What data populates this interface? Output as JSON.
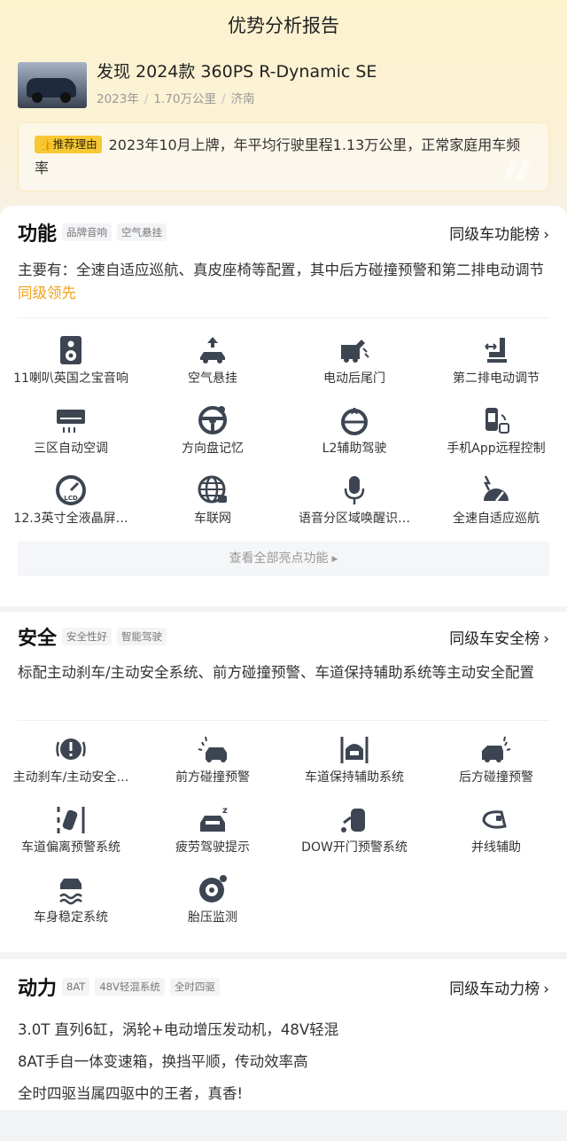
{
  "header": {
    "title": "优势分析报告"
  },
  "car": {
    "name": "发现 2024款 360PS R-Dynamic SE",
    "year": "2023年",
    "mileage": "1.70万公里",
    "city": "济南"
  },
  "reason": {
    "badge": "推荐理由",
    "text": "2023年10月上牌，年平均行驶里程1.13万公里，正常家庭用车频率"
  },
  "function": {
    "title": "功能",
    "tags": [
      "品牌音响",
      "空气悬挂"
    ],
    "rank_label": "同级车功能榜",
    "desc_main": "主要有：全速自适应巡航、真皮座椅等配置，其中后方碰撞预警和第二排电动调节",
    "desc_highlight": "同级领先",
    "items": [
      {
        "label": "11喇叭英国之宝音响",
        "icon": "speaker-icon"
      },
      {
        "label": "空气悬挂",
        "icon": "air-suspension-icon"
      },
      {
        "label": "电动后尾门",
        "icon": "power-tailgate-icon"
      },
      {
        "label": "第二排电动调节",
        "icon": "power-seat-icon"
      },
      {
        "label": "三区自动空调",
        "icon": "air-conditioner-icon"
      },
      {
        "label": "方向盘记忆",
        "icon": "steering-memory-icon"
      },
      {
        "label": "L2辅助驾驶",
        "icon": "assisted-driving-icon"
      },
      {
        "label": "手机App远程控制",
        "icon": "phone-remote-icon"
      },
      {
        "label": "12.3英寸全液晶屏…",
        "icon": "lcd-gauge-icon"
      },
      {
        "label": "车联网",
        "icon": "globe-icon"
      },
      {
        "label": "语音分区域唤醒识…",
        "icon": "microphone-icon"
      },
      {
        "label": "全速自适应巡航",
        "icon": "cruise-control-icon"
      }
    ],
    "more_label": "查看全部亮点功能"
  },
  "safety": {
    "title": "安全",
    "tags": [
      "安全性好",
      "智能驾驶"
    ],
    "rank_label": "同级车安全榜",
    "desc": "标配主动刹车/主动安全系统、前方碰撞预警、车道保持辅助系统等主动安全配置",
    "items": [
      {
        "label": "主动刹车/主动安全…",
        "icon": "brake-warning-icon"
      },
      {
        "label": "前方碰撞预警",
        "icon": "front-collision-icon"
      },
      {
        "label": "车道保持辅助系统",
        "icon": "lane-keep-icon"
      },
      {
        "label": "后方碰撞预警",
        "icon": "rear-collision-icon"
      },
      {
        "label": "车道偏离预警系统",
        "icon": "lane-departure-icon"
      },
      {
        "label": "疲劳驾驶提示",
        "icon": "fatigue-icon"
      },
      {
        "label": "DOW开门预警系统",
        "icon": "door-open-warning-icon"
      },
      {
        "label": "并线辅助",
        "icon": "blind-spot-icon"
      },
      {
        "label": "车身稳定系统",
        "icon": "stability-icon"
      },
      {
        "label": "胎压监测",
        "icon": "tire-pressure-icon"
      }
    ]
  },
  "power": {
    "title": "动力",
    "tags": [
      "8AT",
      "48V轻混系统",
      "全时四驱"
    ],
    "rank_label": "同级车动力榜",
    "lines": [
      "3.0T 直列6缸，涡轮+电动增压发动机，48V轻混",
      "8AT手自一体变速箱，换挡平顺，传动效率高",
      "全时四驱当属四驱中的王者，真香!"
    ]
  }
}
